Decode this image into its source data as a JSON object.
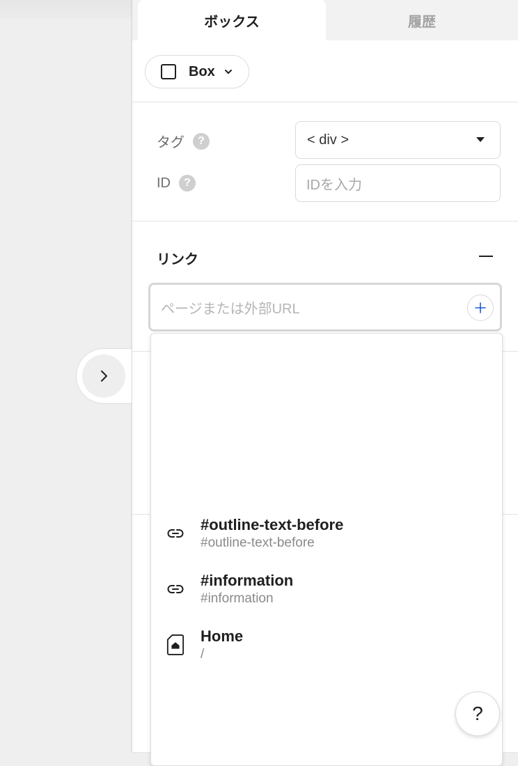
{
  "tabs": [
    {
      "label": "ボックス",
      "active": true
    },
    {
      "label": "履歴",
      "active": false
    }
  ],
  "element_selector": {
    "label": "Box"
  },
  "properties": {
    "tag": {
      "label": "タグ",
      "value": "< div >"
    },
    "id": {
      "label": "ID",
      "placeholder": "IDを入力"
    }
  },
  "link_section": {
    "title": "リンク",
    "url_placeholder": "ページまたは外部URL"
  },
  "suggestions": [
    {
      "title": "#outline-text-before",
      "subtitle": "#outline-text-before",
      "icon": "link-icon"
    },
    {
      "title": "#information",
      "subtitle": "#information",
      "icon": "link-icon"
    },
    {
      "title": "Home",
      "subtitle": "/",
      "icon": "home-page-icon"
    }
  ],
  "help": {
    "label": "?"
  },
  "colors": {
    "accent": "#1a5bd6",
    "muted": "#a3a3a3",
    "border": "#d9d9d9"
  }
}
